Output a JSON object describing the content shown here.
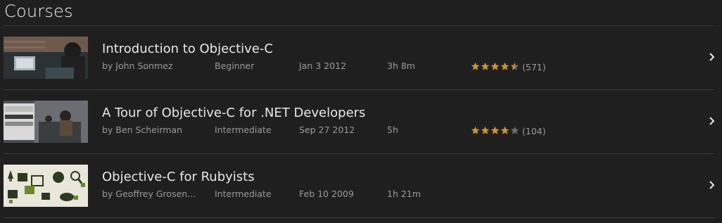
{
  "page": {
    "title": "Courses"
  },
  "colors": {
    "star_filled": "#c8962d",
    "star_empty": "#6b6b6b",
    "background": "#1f1f1f"
  },
  "courses": [
    {
      "title": "Introduction to Objective-C",
      "author": "by John Sonmez",
      "level": "Beginner",
      "date": "Jan 3 2012",
      "duration": "3h 8m",
      "rating": 4.5,
      "rating_count": "(571)"
    },
    {
      "title": "A Tour of Objective-C for .NET Developers",
      "author": "by Ben Scheirman",
      "level": "Intermediate",
      "date": "Sep 27 2012",
      "duration": "5h",
      "rating": 4,
      "rating_count": "(104)"
    },
    {
      "title": "Objective-C for Rubyists",
      "author": "by Geoffrey Grosen...",
      "level": "Intermediate",
      "date": "Feb 10 2009",
      "duration": "1h 21m",
      "rating": null,
      "rating_count": ""
    }
  ]
}
